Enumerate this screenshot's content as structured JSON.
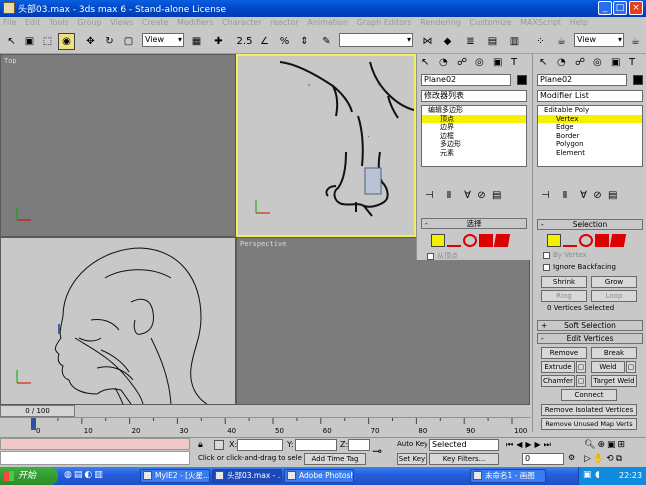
{
  "window": {
    "title": "头部03.max - 3ds max 6 - Stand-alone License"
  },
  "menu": [
    "File",
    "Edit",
    "Tools",
    "Group",
    "Views",
    "Create",
    "Modifiers",
    "Character",
    "reactor",
    "Animation",
    "Graph Editors",
    "Rendering",
    "Customize",
    "MAXScript",
    "Help"
  ],
  "toolbar": {
    "view_dropdown_left": "View",
    "view_dropdown_right": "View"
  },
  "viewports": {
    "top": "Top",
    "front_label": "",
    "left_label": "",
    "perspective": "Perspective"
  },
  "panel_cn": {
    "object_name": "Plane02",
    "modifier_list": "修改器列表",
    "stack": [
      "编辑多边形",
      "顶点",
      "边界",
      "边框",
      "多边形",
      "元素"
    ],
    "selection_title": "选择",
    "by_vertex": "从顶点"
  },
  "panel_en": {
    "object_name": "Plane02",
    "modifier_list": "Modifier List",
    "stack": [
      "Editable Poly",
      "Vertex",
      "Edge",
      "Border",
      "Polygon",
      "Element"
    ],
    "selection_title": "Selection",
    "by_vertex": "By Vertex",
    "ignore_backfacing": "Ignore Backfacing",
    "shrink": "Shrink",
    "grow": "Grow",
    "ring": "Ring",
    "loop": "Loop",
    "selected_info": "0 Vertices Selected",
    "soft_selection": "Soft Selection",
    "edit_vertices": "Edit Vertices",
    "remove": "Remove",
    "break": "Break",
    "extrude": "Extrude",
    "weld": "Weld",
    "chamfer": "Chamfer",
    "target_weld": "Target Weld",
    "connect": "Connect",
    "remove_isolated": "Remove Isolated Vertices",
    "remove_unused": "Remove Unused Map Verts"
  },
  "timeline": {
    "frame": "0 / 100",
    "ticks": [
      "0",
      "10",
      "20",
      "30",
      "40",
      "50",
      "60",
      "70",
      "80",
      "90",
      "100"
    ]
  },
  "status": {
    "x_label": "X:",
    "y_label": "Y:",
    "z_label": "Z:",
    "prompt": "Click or click-and-drag to select ol",
    "add_time_tag": "Add Time Tag",
    "auto_key": "Auto Key",
    "set_key": "Set Key",
    "selected": "Selected",
    "key_filters": "Key Filters...",
    "frame_value": "0"
  },
  "taskbar": {
    "start": "开始",
    "tasks": [
      "MyIE2 - [火星...",
      "头部03.max - ...",
      "Adobe Photoshop",
      "未命名1 - 画图"
    ],
    "clock": "22:23"
  }
}
